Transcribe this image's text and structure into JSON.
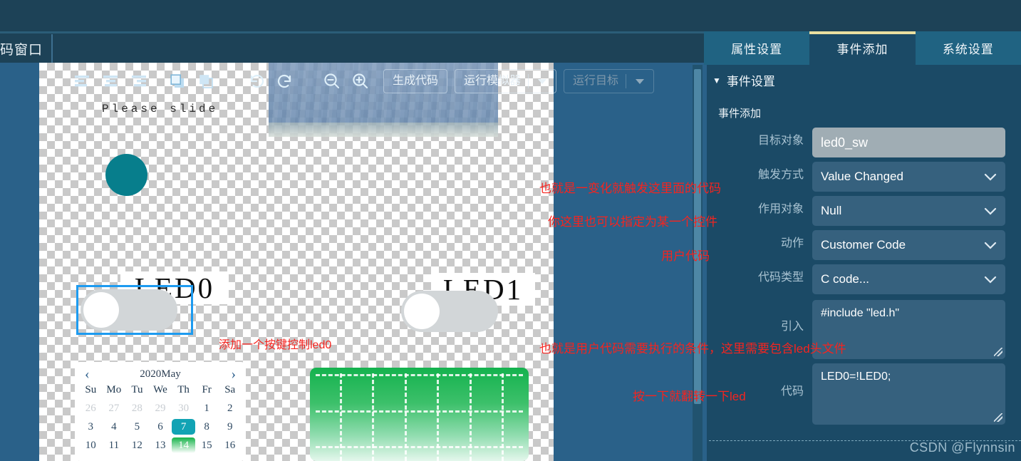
{
  "window": {
    "corner_label": "码窗口"
  },
  "tabs": [
    {
      "label": "属性设置",
      "active": false
    },
    {
      "label": "事件添加",
      "active": true
    },
    {
      "label": "系统设置",
      "active": false
    }
  ],
  "toolbar": {
    "icons": [
      "align-left-icon",
      "align-center-icon",
      "align-right-icon",
      "bring-to-front-icon",
      "send-to-back-icon",
      "undo-icon",
      "redo-icon",
      "zoom-out-icon",
      "zoom-in-icon"
    ],
    "generate_code": "生成代码",
    "run_simulator": "运行模拟器",
    "run_target": "运行目标"
  },
  "canvas": {
    "slider_hint": "Please slide",
    "led0_label": "LED0",
    "led1_label": "LED1",
    "note_add_key": "添加一个按键控制led0",
    "calendar": {
      "title": "2020May",
      "prev": "‹",
      "next": "›",
      "dow": [
        "Su",
        "Mo",
        "Tu",
        "We",
        "Th",
        "Fr",
        "Sa"
      ],
      "weeks": [
        [
          {
            "d": "26",
            "state": "muted"
          },
          {
            "d": "27",
            "state": "muted"
          },
          {
            "d": "28",
            "state": "muted"
          },
          {
            "d": "29",
            "state": "muted"
          },
          {
            "d": "30",
            "state": "muted"
          },
          {
            "d": "1",
            "state": "normal"
          },
          {
            "d": "2",
            "state": "normal"
          }
        ],
        [
          {
            "d": "3",
            "state": "normal"
          },
          {
            "d": "4",
            "state": "normal"
          },
          {
            "d": "5",
            "state": "normal"
          },
          {
            "d": "6",
            "state": "normal"
          },
          {
            "d": "7",
            "state": "selected"
          },
          {
            "d": "8",
            "state": "normal"
          },
          {
            "d": "9",
            "state": "normal"
          }
        ],
        [
          {
            "d": "10",
            "state": "normal"
          },
          {
            "d": "11",
            "state": "normal"
          },
          {
            "d": "12",
            "state": "normal"
          },
          {
            "d": "13",
            "state": "normal"
          },
          {
            "d": "14",
            "state": "today"
          },
          {
            "d": "15",
            "state": "normal"
          },
          {
            "d": "16",
            "state": "normal"
          }
        ]
      ]
    }
  },
  "panel": {
    "section_title": "事件设置",
    "subtitle": "事件添加",
    "fields": {
      "target_object_label": "目标对象",
      "target_object_value": "led0_sw",
      "trigger_label": "触发方式",
      "trigger_value": "Value Changed",
      "scope_label": "作用对象",
      "scope_value": "Null",
      "action_label": "动作",
      "action_value": "Customer Code",
      "code_type_label": "代码类型",
      "code_type_value": "C code...",
      "include_label": "引入",
      "include_value": "#include \"led.h\"",
      "code_label": "代码",
      "code_value": "LED0=!LED0;"
    }
  },
  "annotations": {
    "a1": "也就是一变化就触发这里面的代码",
    "a2": "你这里也可以指定为某一个控件",
    "a3": "用户代码",
    "a4": "也就是用户代码需要执行的条件，这里需要包含led头文件",
    "a5": "按一下就翻转一下led"
  },
  "watermark": "CSDN @Flynnsin",
  "colors": {
    "panel_bg": "#1b4a66",
    "canvas_bg": "#2a6189",
    "tab_active_accent": "#eadfa0",
    "annotation_red": "#f5241f",
    "selection_blue": "#1d9bf0",
    "teal": "#077e8c"
  }
}
